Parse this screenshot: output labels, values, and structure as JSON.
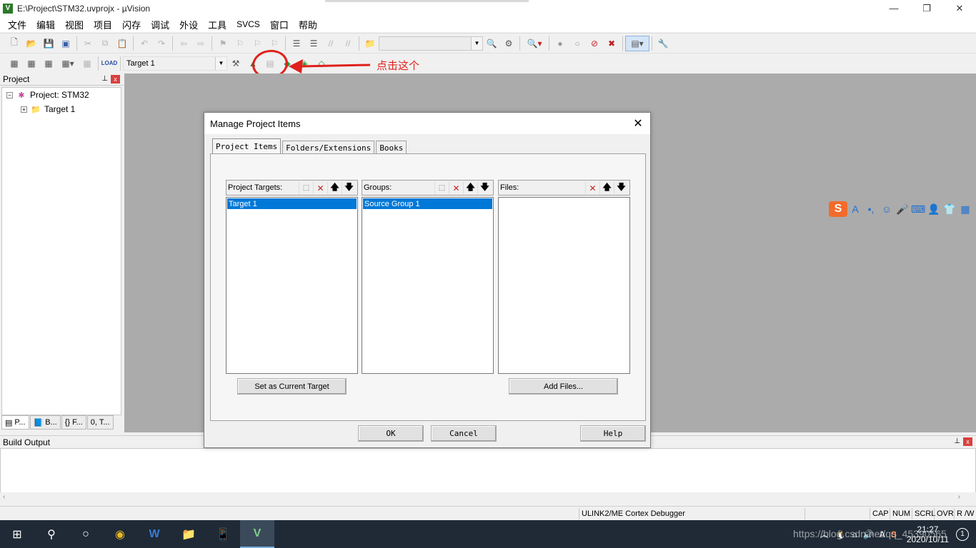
{
  "window": {
    "title": "E:\\Project\\STM32.uvprojx - µVision",
    "app_icon_letter": "V",
    "minimize": "—",
    "maximize": "❐",
    "close": "✕"
  },
  "menu": {
    "items": [
      "文件",
      "编辑",
      "视图",
      "项目",
      "闪存",
      "调试",
      "外设",
      "工具",
      "SVCS",
      "窗口",
      "帮助"
    ]
  },
  "toolbar2": {
    "target_select": "Target 1"
  },
  "annotation": {
    "text": "点击这个",
    "color": "#e0201c"
  },
  "project_panel": {
    "title": "Project",
    "pin": "⊥",
    "close": "x",
    "root_label": "Project: STM32",
    "target_label": "Target 1",
    "tabs": [
      "P...",
      "B...",
      "{} F...",
      "0, T..."
    ]
  },
  "build_output": {
    "title": "Build Output"
  },
  "statusbar": {
    "debugger": "ULINK2/ME Cortex Debugger",
    "cap": "CAP",
    "num": "NUM",
    "scrl": "SCRL",
    "ovr": "OVR",
    "rw": "R /W"
  },
  "dialog": {
    "title": "Manage Project Items",
    "close": "✕",
    "tabs": [
      "Project Items",
      "Folders/Extensions",
      "Books"
    ],
    "targets": {
      "label": "Project Targets:",
      "items": [
        "Target 1"
      ]
    },
    "groups": {
      "label": "Groups:",
      "items": [
        "Source Group 1"
      ]
    },
    "files": {
      "label": "Files:"
    },
    "set_current_target": "Set as Current Target",
    "add_files": "Add Files...",
    "ok": "OK",
    "cancel": "Cancel",
    "help": "Help"
  },
  "taskbar": {
    "time": "21:27",
    "date": "2020/10/11",
    "watermark": "https://blog.csdn.net/qq_45390565",
    "notification_count": "1"
  },
  "colors": {
    "selection": "#0078d7",
    "workspace": "#ababab",
    "taskbar": "#1f2a36",
    "sogou": "#f36b2c"
  }
}
